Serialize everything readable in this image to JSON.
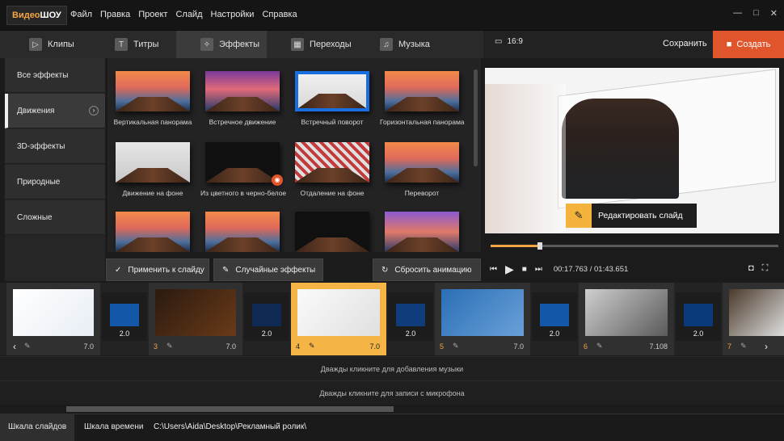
{
  "app": {
    "logo_main": "Видео",
    "logo_accent": "ШОУ"
  },
  "menu": [
    "Файл",
    "Правка",
    "Проект",
    "Слайд",
    "Настройки",
    "Справка"
  ],
  "window_controls": {
    "minimize": "—",
    "maximize": "□",
    "close": "✕"
  },
  "tabs": [
    {
      "label": "Клипы",
      "icon": "clip-icon"
    },
    {
      "label": "Титры",
      "icon": "titles-icon"
    },
    {
      "label": "Эффекты",
      "icon": "effects-icon",
      "active": true
    },
    {
      "label": "Переходы",
      "icon": "transitions-icon"
    },
    {
      "label": "Музыка",
      "icon": "music-icon"
    }
  ],
  "categories": [
    {
      "label": "Все эффекты"
    },
    {
      "label": "Движения",
      "active": true
    },
    {
      "label": "3D-эффекты"
    },
    {
      "label": "Природные"
    },
    {
      "label": "Сложные"
    }
  ],
  "effects": [
    {
      "label": "Вертикальная панорама"
    },
    {
      "label": "Встречное движение"
    },
    {
      "label": "Встречный поворот"
    },
    {
      "label": "Горизонтальная панорама"
    },
    {
      "label": "Движение на фоне"
    },
    {
      "label": "Из цветного в черно-белое"
    },
    {
      "label": "Отдаление на фоне"
    },
    {
      "label": "Переворот"
    }
  ],
  "actions": {
    "apply": "Применить к слайду",
    "random": "Случайные эффекты",
    "reset": "Сбросить анимацию"
  },
  "preview": {
    "aspect_ratio": "16:9",
    "save": "Сохранить",
    "create": "Создать",
    "edit_slide": "Редактировать слайд",
    "time_current": "00:17.763",
    "time_separator": " / ",
    "time_total": "01:43.651",
    "progress_fraction": 0.17
  },
  "slides": [
    {
      "num": "",
      "dur": "7.0"
    },
    {
      "num": "3",
      "dur": "7.0"
    },
    {
      "num": "4",
      "dur": "7.0",
      "selected": true
    },
    {
      "num": "5",
      "dur": "7.0"
    },
    {
      "num": "6",
      "dur": "7.108"
    },
    {
      "num": "7",
      "dur": ""
    }
  ],
  "transitions": [
    "2.0",
    "2.0",
    "2.0",
    "2.0",
    "2.0",
    "2.0"
  ],
  "audio": {
    "music_hint": "Дважды кликните для добавления музыки",
    "mic_hint": "Дважды кликните для записи с микрофона"
  },
  "bottom": {
    "tab_slides": "Шкала слайдов",
    "tab_time": "Шкала времени",
    "path": "C:\\Users\\Aida\\Desktop\\Рекламный ролик\\"
  },
  "colors": {
    "accent": "#f5b546",
    "create": "#e0552c"
  }
}
